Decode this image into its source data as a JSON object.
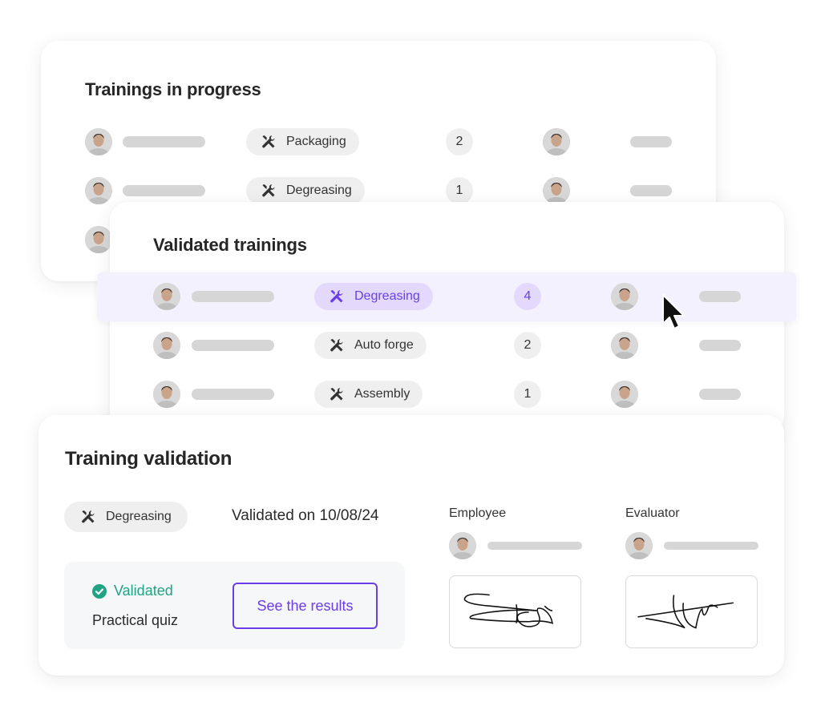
{
  "trainings_in_progress": {
    "title": "Trainings in progress",
    "rows": [
      {
        "training": "Packaging",
        "count": "2",
        "trainee_avatar": "woman-bun",
        "trainer_avatar": "man-pink-bg"
      },
      {
        "training": "Degreasing",
        "count": "1",
        "trainee_avatar": "man-blue-shirt",
        "trainer_avatar": "man-smiling"
      },
      {
        "training": "",
        "count": "",
        "trainee_avatar": "man-bald-smiling",
        "trainer_avatar": ""
      }
    ]
  },
  "validated_trainings": {
    "title": "Validated trainings",
    "rows": [
      {
        "training": "Degreasing",
        "count": "4",
        "highlighted": true,
        "trainee_avatar": "woman-gray",
        "trainer_avatar": "man-curly-hair"
      },
      {
        "training": "Auto forge",
        "count": "2",
        "highlighted": false,
        "trainee_avatar": "man-beard",
        "trainer_avatar": "woman-long-hair"
      },
      {
        "training": "Assembly",
        "count": "1",
        "highlighted": false,
        "trainee_avatar": "man-dark-shirt",
        "trainer_avatar": "woman-dark-hair"
      }
    ]
  },
  "training_validation": {
    "title": "Training validation",
    "training": "Degreasing",
    "validated_on": "Validated on 10/08/24",
    "status": "Validated",
    "quiz_label": "Practical quiz",
    "results_button": "See the results",
    "employee_label": "Employee",
    "evaluator_label": "Evaluator"
  },
  "icons": {
    "training": "tools-icon",
    "status": "check-circle-icon",
    "cursor": "mouse-pointer-icon"
  },
  "colors": {
    "accent": "#6a3ee8",
    "accent_bg": "#e3d9fd",
    "highlight_row": "#f4f1fe",
    "success": "#1fa382",
    "pill_bg": "#efefef",
    "placeholder_bar": "#d6d6d6"
  }
}
